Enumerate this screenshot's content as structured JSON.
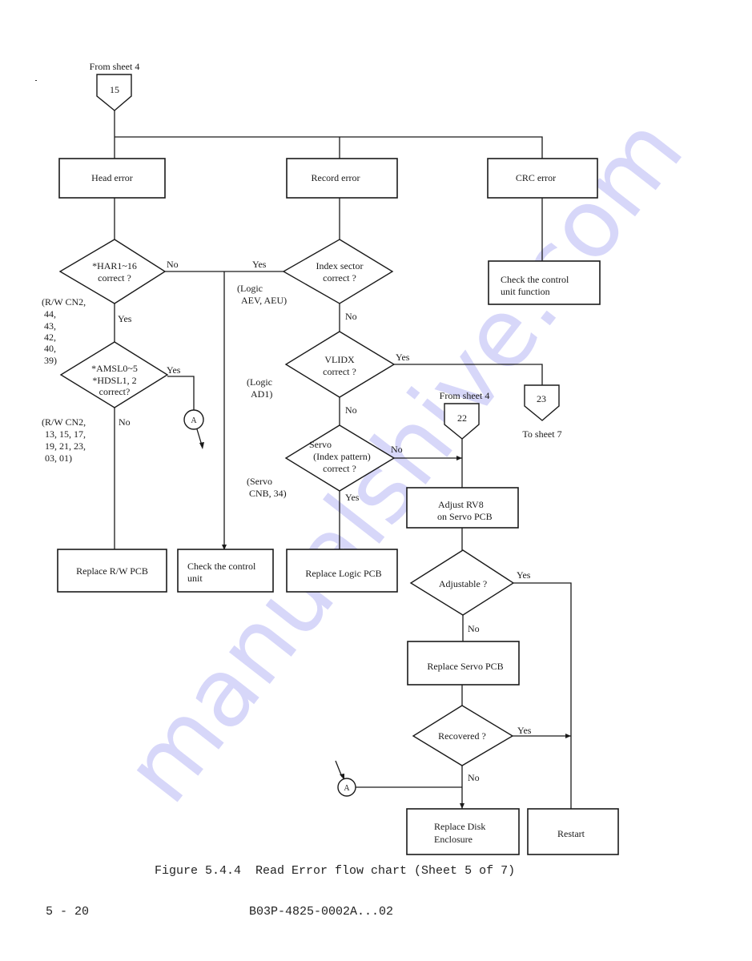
{
  "connectors": {
    "entry": {
      "label": "From sheet 4",
      "number": "15"
    },
    "entry2": {
      "label": "From sheet 4",
      "number": "22"
    },
    "exit": {
      "label": "To sheet 7",
      "number": "23"
    },
    "offpage_a": "A"
  },
  "process": {
    "head_error": "Head error",
    "record_error": "Record error",
    "crc_error": "CRC error",
    "check_control_unit_function": [
      "Check the control",
      "unit function"
    ],
    "replace_rw_pcb": "Replace R/W PCB",
    "check_control_unit": [
      "Check the control",
      "unit"
    ],
    "replace_logic_pcb": "Replace Logic PCB",
    "adjust_rv8": [
      "Adjust RV8",
      "on Servo PCB"
    ],
    "replace_servo_pcb": "Replace Servo PCB",
    "replace_disk_enclosure": [
      "Replace Disk",
      "Enclosure"
    ],
    "restart": "Restart"
  },
  "decisions": {
    "har": [
      "*HAR1~16",
      "correct ?"
    ],
    "amsl": [
      "*AMSL0~5",
      "*HDSL1, 2",
      "correct?"
    ],
    "index_sector": [
      "Index sector",
      "correct ?"
    ],
    "vlidx": [
      "VLIDX",
      "correct ?"
    ],
    "servo": [
      "Servo",
      "(Index pattern)",
      "correct ?"
    ],
    "adjustable": "Adjustable ?",
    "recovered": "Recovered ?"
  },
  "branch_labels": {
    "yes": "Yes",
    "no": "No"
  },
  "notes": {
    "rw_cn2_a": [
      "(R/W CN2,",
      "44,",
      "43,",
      "42,",
      "40,",
      "39)"
    ],
    "rw_cn2_b": [
      "(R/W CN2,",
      "13, 15, 17,",
      "19, 21, 23,",
      "03, 01)"
    ],
    "logic_aev": [
      "(Logic",
      "AEV, AEU)"
    ],
    "logic_ad1": [
      "(Logic",
      "AD1)"
    ],
    "servo_cnb": [
      "(Servo",
      "CNB, 34)"
    ]
  },
  "caption": "Figure 5.4.4  Read Error flow chart (Sheet 5 of 7)",
  "footer": {
    "page_number": "5 - 20",
    "doc_id": "B03P-4825-0002A...02"
  },
  "watermark": "manualshive.com"
}
